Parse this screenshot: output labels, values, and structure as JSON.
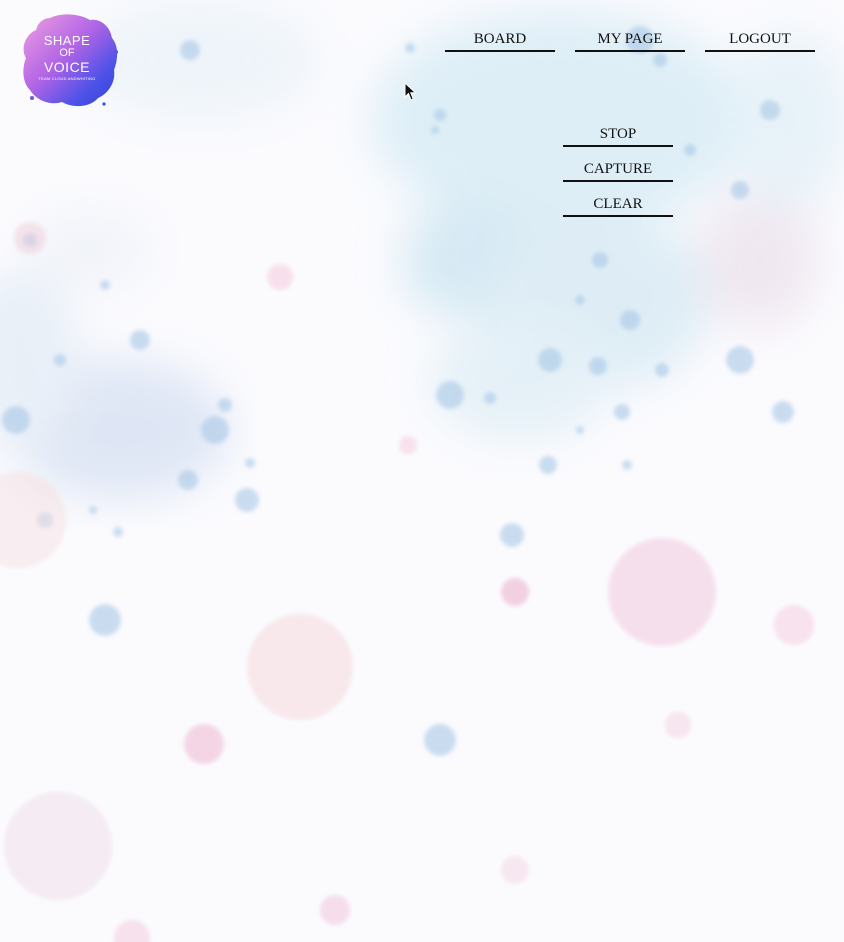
{
  "logo": {
    "line1": "SHAPE",
    "line2": "OF",
    "line3": "VOICE",
    "line4": "TEAM CLOUD ANDWHITING"
  },
  "nav": {
    "board": "BOARD",
    "my_page": "MY PAGE",
    "logout": "LOGOUT"
  },
  "controls": {
    "stop": "STOP",
    "capture": "CAPTURE",
    "clear": "CLEAR"
  },
  "colors": {
    "background": "#fbfbfe",
    "text": "#111111",
    "splash_blue": "#a9d3e8",
    "splash_pink": "#f2b6d0",
    "logo_purple": "#5a3fd9",
    "logo_pink": "#e98bd6"
  }
}
